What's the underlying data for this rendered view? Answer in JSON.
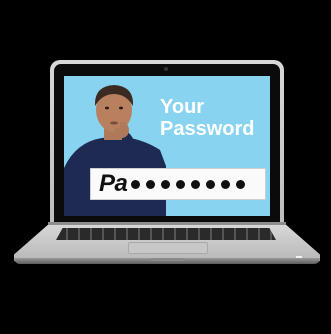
{
  "screen": {
    "headline": [
      "Your",
      "Password"
    ],
    "password_prefix": "Pa",
    "masked_char_count": 8,
    "background_color": "#88d3ef"
  },
  "device": {
    "type": "laptop",
    "body_color": "#c8c8c8"
  }
}
